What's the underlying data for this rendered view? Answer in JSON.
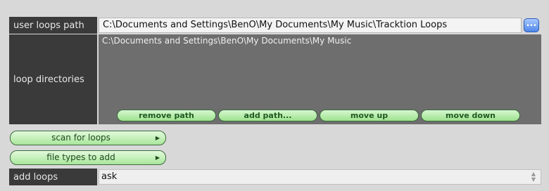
{
  "user_loops": {
    "label": "user loops path",
    "path": "C:\\Documents and Settings\\BenO\\My Documents\\My Music\\Tracktion Loops",
    "browse_label": "..."
  },
  "loop_directories": {
    "label": "loop directories",
    "items": [
      "C:\\Documents and Settings\\BenO\\My Documents\\My Music"
    ],
    "buttons": {
      "remove": "remove path",
      "add": "add path...",
      "up": "move up",
      "down": "move down"
    }
  },
  "scan_button": {
    "label": "scan for loops"
  },
  "file_types_button": {
    "label": "file types to add"
  },
  "add_loops": {
    "label": "add loops",
    "value": "ask"
  },
  "colors": {
    "label_bg": "#3a3a3a",
    "dirs_bg": "#6e6e6e",
    "button_green": "#a9e69b",
    "browse_blue": "#4f86e8"
  }
}
